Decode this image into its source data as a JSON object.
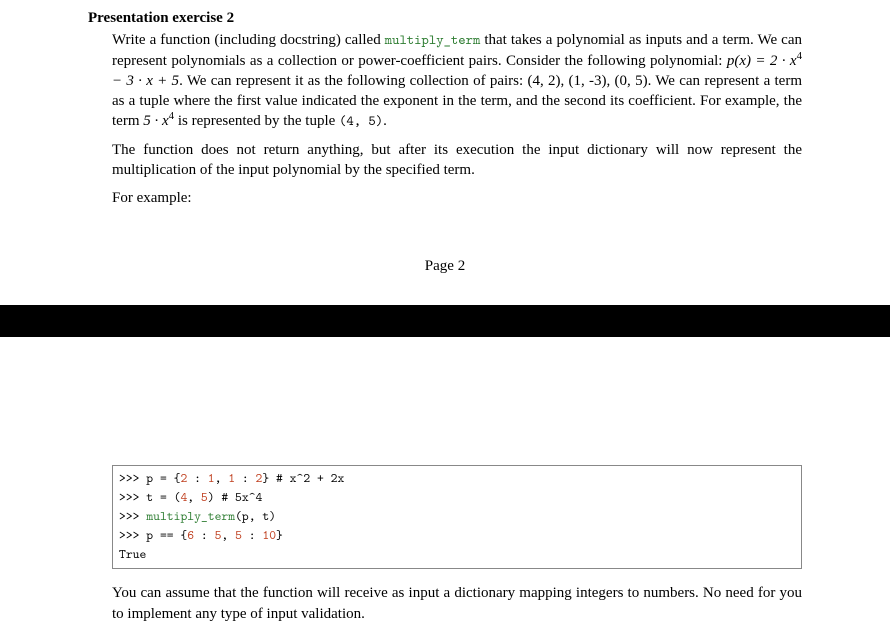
{
  "heading": "Presentation exercise 2",
  "p1a": "Write a function (including docstring) called ",
  "func_name": "multiply_term",
  "p1b": " that takes a polynomial as inputs and a term. We can represent polynomials as a collection or power-coefficient pairs. Consider the following polynomial: ",
  "poly_lhs": "p(x) = 2 · x",
  "poly_exp1": "4",
  "poly_mid": " − 3 · x + 5",
  "p1c": ". We can represent it as the following collection of pairs: (4, 2), (1, -3), (0, 5). We can represent a term as a tuple where the first value indicated the exponent in the term, and the second its coefficient. For example, the term ",
  "term_lhs": "5 · x",
  "term_exp": "4",
  "p1d": " is represented by the tuple ",
  "term_tuple": "(4, 5)",
  "p1e": ".",
  "p2": "The function does not return anything, but after its execution the input dictionary will now represent the multiplication of the input polynomial by the specified term.",
  "p3": "For example:",
  "page_num": "Page 2",
  "code": {
    "l1a": ">>> p = {",
    "l1n1": "2",
    "l1b": " : ",
    "l1n2": "1",
    "l1c": ", ",
    "l1n3": "1",
    "l1d": " : ",
    "l1n4": "2",
    "l1e": "} # x^2 + 2x",
    "l2a": ">>> t = (",
    "l2n1": "4",
    "l2b": ", ",
    "l2n2": "5",
    "l2c": ") # 5x^4",
    "l3a": ">>> ",
    "l3fn": "multiply_term",
    "l3b": "(p, t)",
    "l4a": ">>> p == {",
    "l4n1": "6",
    "l4b": " : ",
    "l4n2": "5",
    "l4c": ", ",
    "l4n3": "5",
    "l4d": " : ",
    "l4n4": "10",
    "l4e": "}",
    "l5": "True"
  },
  "p4": "You can assume that the function will receive as input a dictionary mapping integers to numbers. No need for you to implement any type of input validation."
}
